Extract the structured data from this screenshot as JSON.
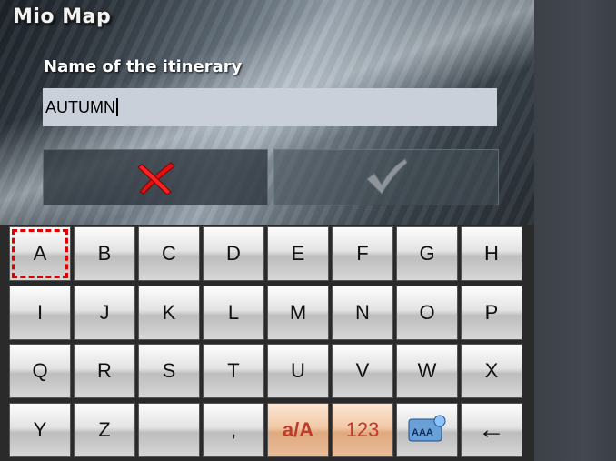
{
  "app": {
    "title": "Mio Map"
  },
  "form": {
    "label": "Name of the itinerary",
    "value": "AUTUMN"
  },
  "actions": {
    "cancel_icon": "red-x-icon",
    "confirm_icon": "checkmark-icon"
  },
  "keyboard": {
    "rows": [
      [
        "A",
        "B",
        "C",
        "D",
        "E",
        "F",
        "G",
        "H"
      ],
      [
        "I",
        "J",
        "K",
        "L",
        "M",
        "N",
        "O",
        "P"
      ],
      [
        "Q",
        "R",
        "S",
        "T",
        "U",
        "V",
        "W",
        "X"
      ],
      [
        "Y",
        "Z",
        "",
        ",",
        "a/A",
        "123",
        "",
        "←"
      ]
    ],
    "selected_key": "A",
    "special": {
      "case_toggle": "a/A",
      "numeric": "123",
      "layout_icon": "aaa-keyboard-layout-icon",
      "backspace_icon": "left-arrow-icon"
    }
  },
  "colors": {
    "selection": "#e00000",
    "input_bg": "#c9d0da",
    "accent_key": "#f2c9a6"
  }
}
